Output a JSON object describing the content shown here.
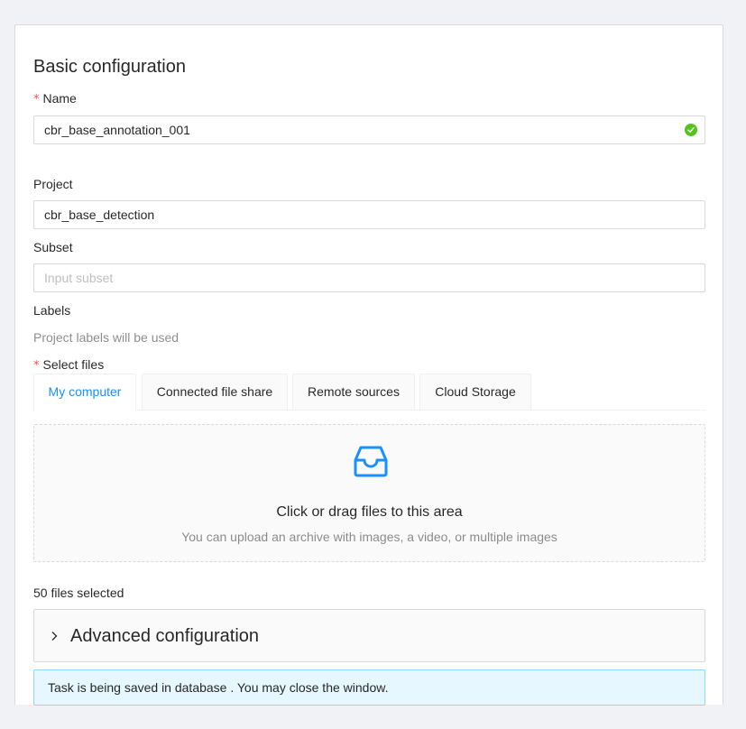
{
  "section": {
    "title": "Basic configuration"
  },
  "name_field": {
    "label": "Name",
    "required_mark": "*",
    "value": "cbr_base_annotation_001",
    "status_icon": "check-circle-icon",
    "status_color": "#52c41a"
  },
  "project_field": {
    "label": "Project",
    "value": "cbr_base_detection"
  },
  "subset_field": {
    "label": "Subset",
    "placeholder": "Input subset",
    "value": ""
  },
  "labels_field": {
    "label": "Labels",
    "note": "Project labels will be used"
  },
  "files": {
    "label": "Select files",
    "required_mark": "*",
    "tabs": [
      {
        "label": "My computer",
        "active": true
      },
      {
        "label": "Connected file share",
        "active": false
      },
      {
        "label": "Remote sources",
        "active": false
      },
      {
        "label": "Cloud Storage",
        "active": false
      }
    ],
    "dropzone": {
      "icon": "inbox-icon",
      "text": "Click or drag files to this area",
      "hint": "You can upload an archive with images, a video, or multiple images"
    },
    "selected_count_text": "50 files selected"
  },
  "advanced": {
    "title": "Advanced configuration",
    "icon": "chevron-right-icon",
    "expanded": false
  },
  "status_alert": {
    "text": "Task is being saved in database . You may close the window."
  },
  "colors": {
    "accent": "#1890ff",
    "required": "#ff4d4f",
    "success": "#52c41a",
    "alert_bg": "#e6f7ff",
    "alert_border": "#91d5ff"
  }
}
